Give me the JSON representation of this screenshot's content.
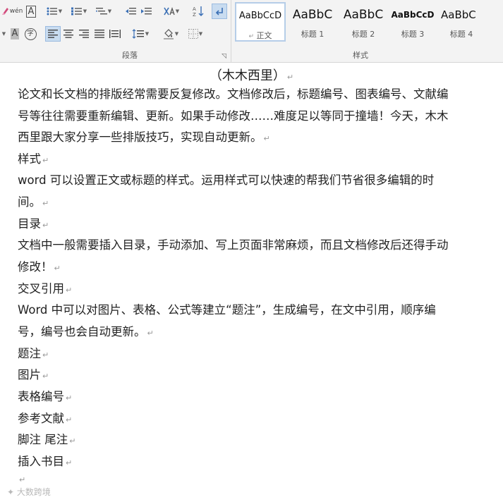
{
  "ribbon": {
    "paragraph_group_label": "段落",
    "styles_group_label": "样式",
    "launcher_glyph": "◹",
    "styles": [
      {
        "preview": "AaBbCcD",
        "name": "正文",
        "selected": true
      },
      {
        "preview": "AaBbC",
        "name": "标题 1"
      },
      {
        "preview": "AaBbC",
        "name": "标题 2"
      },
      {
        "preview": "AaBbCcD",
        "name": "标题 3"
      },
      {
        "preview": "AaBbC",
        "name": "标题 4"
      }
    ],
    "phonetic_glyph": "wén",
    "char_border_glyph": "A",
    "char_shading_glyph": "A",
    "enclose_glyph": "字",
    "normal_style_prefix": "↵"
  },
  "document": {
    "title": "（木木西里）",
    "paragraphs": [
      "论文和长文档的排版经常需要反复修改。文档修改后，标题编号、图表编号、文献编号等往往需要重新编辑、更新。如果手动修改……难度足以等同于撞墙！今天，木木西里跟大家分享一些排版技巧，实现自动更新。",
      "样式",
      "word 可以设置正文或标题的样式。运用样式可以快速的帮我们节省很多编辑的时间。",
      "目录",
      "文档中一般需要插入目录，手动添加、写上页面非常麻烦，而且文档修改后还得手动修改！",
      "交叉引用",
      "Word 中可以对图片、表格、公式等建立“题注”，生成编号，在文中引用，顺序编号，编号也会自动更新。",
      "题注",
      "图片",
      "表格编号",
      "参考文献",
      "脚注 尾注",
      "插入书目",
      ""
    ],
    "paragraph_mark": "↵"
  },
  "watermark": "大数跨境"
}
